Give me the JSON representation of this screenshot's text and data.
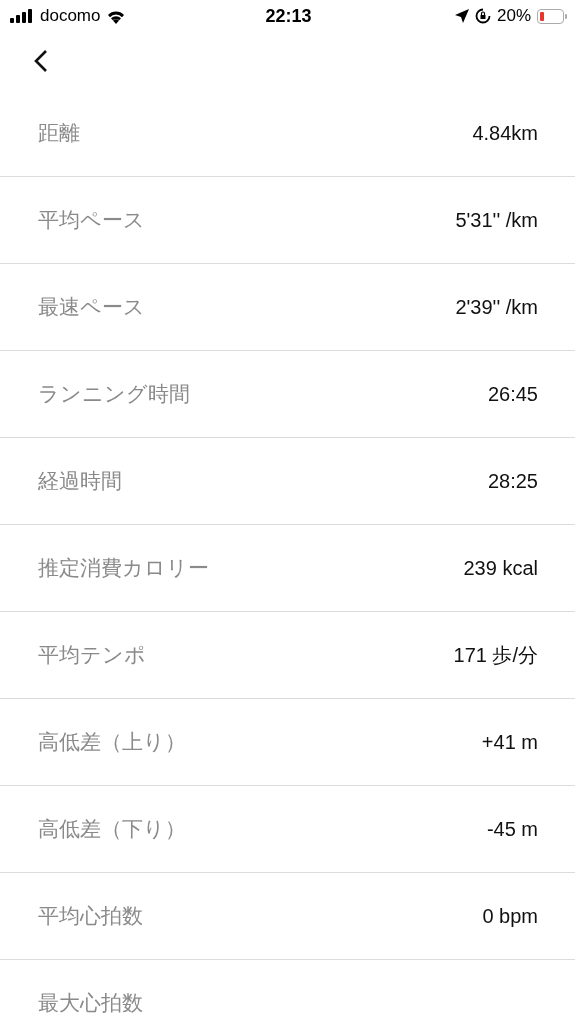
{
  "status_bar": {
    "carrier": "docomo",
    "time": "22:13",
    "battery": "20%"
  },
  "stats": [
    {
      "label": "距離",
      "value": "4.84km"
    },
    {
      "label": "平均ペース",
      "value": "5'31'' /km"
    },
    {
      "label": "最速ペース",
      "value": "2'39'' /km"
    },
    {
      "label": "ランニング時間",
      "value": "26:45"
    },
    {
      "label": "経過時間",
      "value": "28:25"
    },
    {
      "label": "推定消費カロリー",
      "value": "239 kcal"
    },
    {
      "label": "平均テンポ",
      "value": "171 歩/分"
    },
    {
      "label": "高低差（上り）",
      "value": "+41 m"
    },
    {
      "label": "高低差（下り）",
      "value": "-45 m"
    },
    {
      "label": "平均心拍数",
      "value": "0 bpm"
    },
    {
      "label": "最大心拍数"
    }
  ]
}
